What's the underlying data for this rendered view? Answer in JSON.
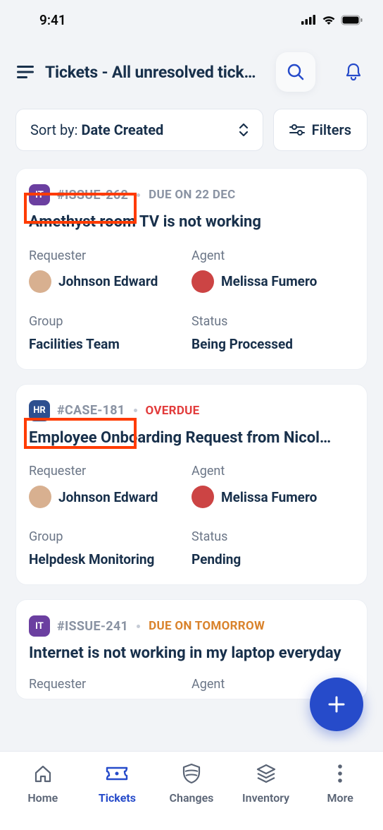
{
  "status_bar": {
    "time": "9:41"
  },
  "page": {
    "title": "Tickets - All unresolved tick…",
    "sort_prefix": "Sort by: ",
    "sort_value": "Date Created",
    "filters_label": "Filters"
  },
  "tickets": [
    {
      "ws_code": "IT",
      "ws_class": "ws-it",
      "id": "#ISSUE-262",
      "due_text": "DUE ON 22 DEC",
      "due_class": "due-gray",
      "title": "Amethyst room TV is not working",
      "requester_label": "Requester",
      "requester": "Johnson Edward",
      "agent_label": "Agent",
      "agent": "Melissa Fumero",
      "group_label": "Group",
      "group": "Facilities Team",
      "status_label": "Status",
      "status": "Being Processed"
    },
    {
      "ws_code": "HR",
      "ws_class": "ws-hr",
      "id": "#CASE-181",
      "due_text": "OVERDUE",
      "due_class": "due-red",
      "title": "Employee Onboarding Request from Nicol…",
      "requester_label": "Requester",
      "requester": "Johnson Edward",
      "agent_label": "Agent",
      "agent": "Melissa Fumero",
      "group_label": "Group",
      "group": "Helpdesk Monitoring",
      "status_label": "Status",
      "status": "Pending"
    },
    {
      "ws_code": "IT",
      "ws_class": "ws-it",
      "id": "#ISSUE-241",
      "due_text": "DUE ON TOMORROW",
      "due_class": "due-amber",
      "title": "Internet is not working in my laptop everyday",
      "requester_label": "Requester",
      "agent_label": "Agent"
    }
  ],
  "nav": {
    "items": [
      {
        "label": "Home",
        "active": false,
        "icon": "home"
      },
      {
        "label": "Tickets",
        "active": true,
        "icon": "ticket"
      },
      {
        "label": "Changes",
        "active": false,
        "icon": "shield"
      },
      {
        "label": "Inventory",
        "active": false,
        "icon": "stack"
      },
      {
        "label": "More",
        "active": false,
        "icon": "dots"
      }
    ]
  }
}
